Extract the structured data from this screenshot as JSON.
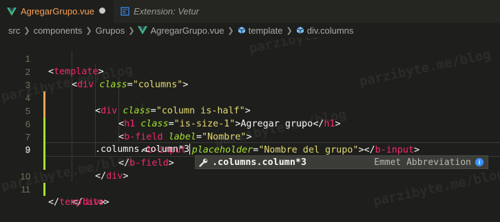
{
  "tabs": [
    {
      "label": "AgregarGrupo.vue",
      "active": true,
      "dirty": true
    },
    {
      "label": "Extension: Vetur",
      "active": false
    }
  ],
  "breadcrumb": [
    {
      "label": "src"
    },
    {
      "label": "components"
    },
    {
      "label": "Grupos"
    },
    {
      "label": "AgregarGrupo.vue",
      "icon": "vue-icon"
    },
    {
      "label": "template",
      "icon": "cube-icon"
    },
    {
      "label": "div.columns",
      "icon": "cube-icon"
    }
  ],
  "line_numbers": [
    "1",
    "2",
    "3",
    "4",
    "5",
    "6",
    "7",
    "8",
    "9",
    "10",
    "11"
  ],
  "current_line": 9,
  "code": {
    "l1": {
      "t1": "<",
      "tag": "template",
      "t2": ">"
    },
    "l2": {
      "t1": "<",
      "tag": "div",
      "attr": "class",
      "eq": "=",
      "val": "\"columns\"",
      "t2": ">"
    },
    "l3": {
      "t1": "<",
      "tag": "div",
      "attr": "class",
      "eq": "=",
      "val": "\"column is-half\"",
      "t2": ">"
    },
    "l4": {
      "t1": "<",
      "tag": "h1",
      "attr": "class",
      "eq": "=",
      "val": "\"is-size-1\"",
      "t2": ">",
      "text": "Agregar grupo",
      "t3": "</",
      "ctag": "h1",
      "t4": ">"
    },
    "l5": {
      "t1": "<",
      "tag": "b-field",
      "attr": "label",
      "eq": "=",
      "val": "\"Nombre\"",
      "t2": ">"
    },
    "l6": {
      "t1": "<",
      "tag": "b-input",
      "attr": "placeholder",
      "eq": "=",
      "val": "\"Nombre del grupo\"",
      "t2": "></",
      "ctag": "b-input",
      "t3": ">"
    },
    "l7": {
      "t1": "</",
      "tag": "b-field",
      "t2": ">"
    },
    "l8": {
      "t1": "</",
      "tag": "div",
      "t2": ">"
    },
    "l9": {
      "text": ".columns.column*3"
    },
    "l10": {
      "t1": "</",
      "tag": "div",
      "t2": ">"
    },
    "l11": {
      "t1": "</",
      "tag": "template",
      "t2": ">"
    }
  },
  "suggestion": {
    "label": ".columns.column*3",
    "detail": "Emmet Abbreviation",
    "info_glyph": "i"
  },
  "watermark": "parzibyte.me/blog",
  "colors": {
    "background": "#1e1f1c",
    "tag": "#f92672",
    "attribute": "#a6e22e",
    "string": "#e6db74",
    "active_tab_text": "#f8a15a",
    "gutter_added": "#a6e22e",
    "gutter_modified": "#f8a15a"
  }
}
